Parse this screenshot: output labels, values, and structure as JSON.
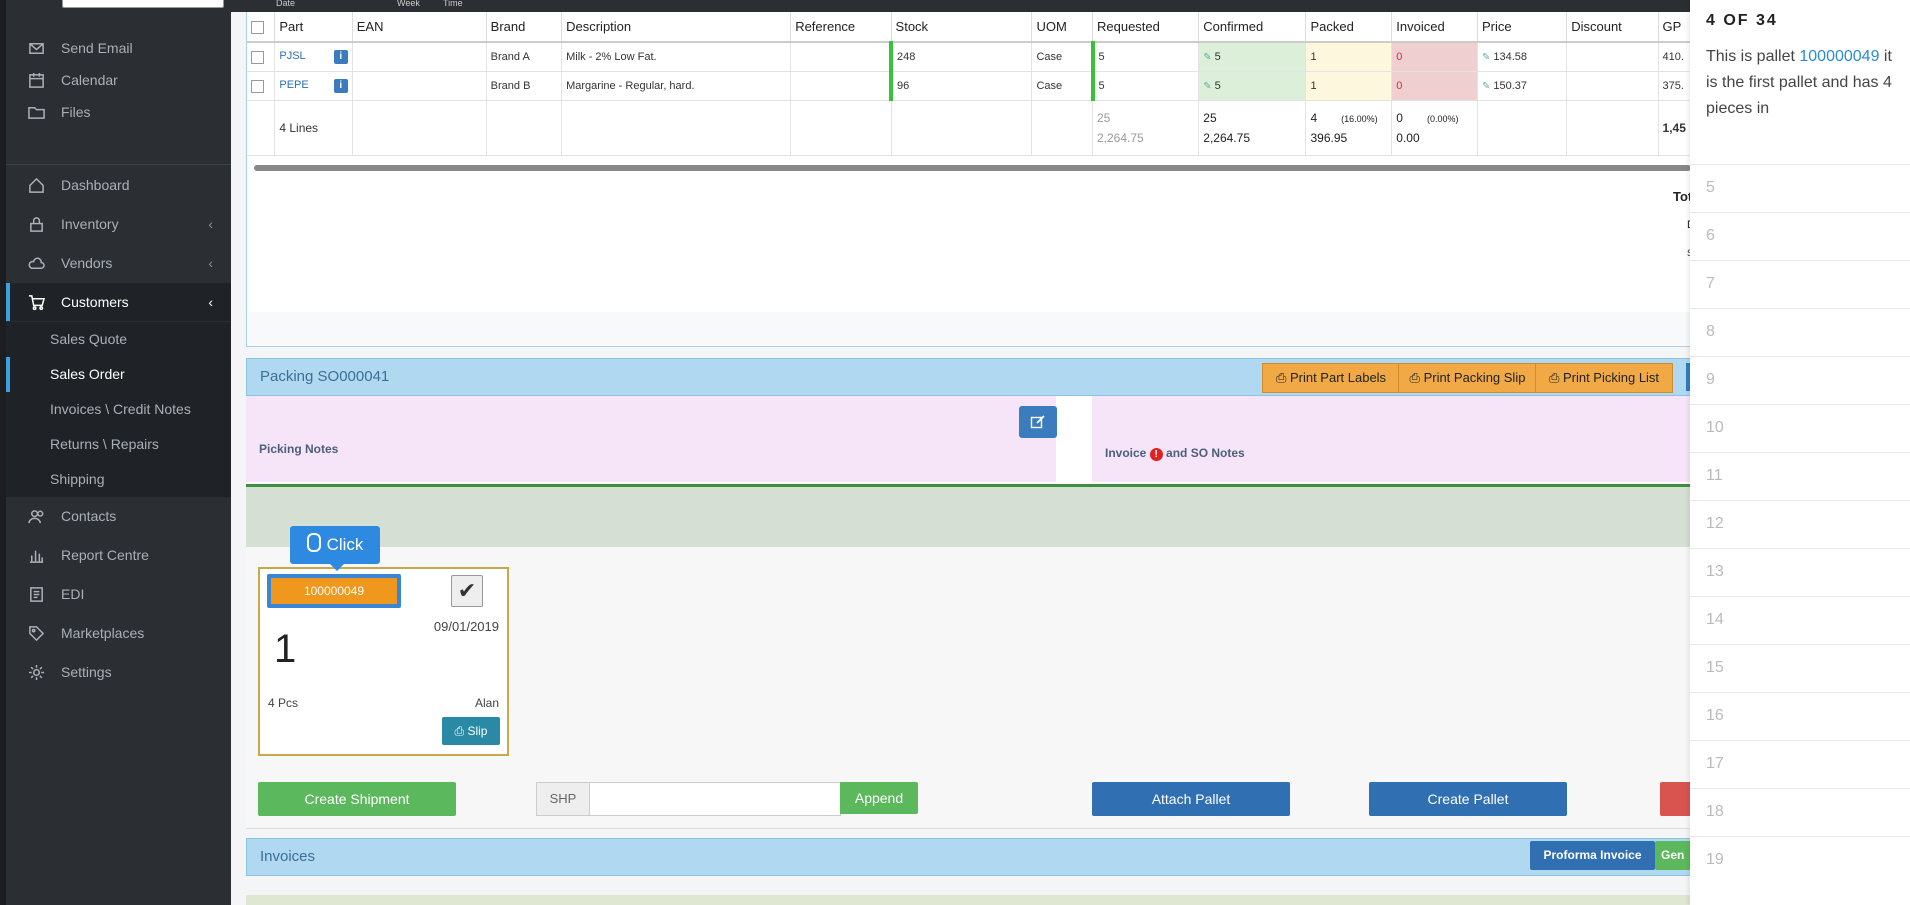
{
  "sidebar": {
    "group1": [
      {
        "label": "Send Email",
        "icon": "mail-icon"
      },
      {
        "label": "Calendar",
        "icon": "calendar-icon"
      },
      {
        "label": "Files",
        "icon": "folder-icon"
      }
    ],
    "group2": [
      {
        "label": "Dashboard",
        "icon": "home-icon"
      },
      {
        "label": "Inventory",
        "icon": "lock-icon"
      },
      {
        "label": "Vendors",
        "icon": "cloud-icon"
      },
      {
        "label": "Customers",
        "icon": "cart-icon"
      }
    ],
    "customers_sub": [
      "Sales Quote",
      "Sales Order",
      "Invoices \\ Credit Notes",
      "Returns \\ Repairs",
      "Shipping"
    ],
    "group3": [
      {
        "label": "Contacts",
        "icon": "contacts-icon"
      },
      {
        "label": "Report Centre",
        "icon": "chart-icon"
      },
      {
        "label": "EDI",
        "icon": "edi-icon"
      },
      {
        "label": "Marketplaces",
        "icon": "tag-icon"
      },
      {
        "label": "Settings",
        "icon": "gear-icon"
      }
    ]
  },
  "datebar": {
    "date": "Date",
    "week": "Week",
    "time": "Time"
  },
  "lines_table": {
    "headers": [
      "",
      "Part",
      "EAN",
      "Brand",
      "Description",
      "Reference",
      "Stock",
      "UOM",
      "Requested",
      "Confirmed",
      "Packed",
      "Invoiced",
      "Price",
      "Discount",
      "GP"
    ],
    "rows": [
      {
        "part": "PJSL",
        "ean": "",
        "brand": "Brand A",
        "description": "Milk - 2% Low Fat.",
        "reference": "",
        "stock": "248",
        "uom": "Case",
        "requested": "5",
        "confirmed": "5",
        "packed": "1",
        "invoiced": "0",
        "price": "134.58",
        "discount": "",
        "gp": "410."
      },
      {
        "part": "PEPE",
        "ean": "",
        "brand": "Brand B",
        "description": "Margarine - Regular, hard.",
        "reference": "",
        "stock": "96",
        "uom": "Case",
        "requested": "5",
        "confirmed": "5",
        "packed": "1",
        "invoiced": "0",
        "price": "150.37",
        "discount": "",
        "gp": "375."
      }
    ],
    "totals": {
      "lines": "4 Lines",
      "requested_qty": "25",
      "requested_val": "2,264.75",
      "confirmed_qty": "25",
      "confirmed_val": "2,264.75",
      "packed_qty": "4",
      "packed_pct": "(16.00%)",
      "packed_val": "396.95",
      "invoiced_qty": "0",
      "invoiced_pct": "(0.00%)",
      "invoiced_val": "0.00",
      "gp": "1,45"
    },
    "side_text": {
      "tot": "Tot",
      "d": "D",
      "s": "S"
    }
  },
  "packing": {
    "title": "Packing SO000041",
    "buttons": [
      "Print Part Labels",
      "Print Packing Slip",
      "Print Picking List"
    ],
    "picking_notes": "Picking Notes",
    "invoice_notes_prefix": "Invoice",
    "invoice_notes_suffix": "and SO Notes",
    "pallet": {
      "id": "100000049",
      "date": "09/01/2019",
      "number": "1",
      "pcs": "4 Pcs",
      "user": "Alan",
      "slip": "Slip"
    },
    "click_tip": "Click",
    "create_shipment": "Create Shipment",
    "shp_prefix": "SHP",
    "shp_value": "",
    "append": "Append",
    "attach_pallet": "Attach Pallet",
    "create_pallet": "Create Pallet"
  },
  "invoices": {
    "title": "Invoices",
    "proforma": "Proforma Invoice",
    "gen": "Gen"
  },
  "tour": {
    "title": "4 OF 34",
    "body_before": "This is pallet",
    "body_link": "100000049",
    "body_after": "it is the first pallet and has 4 pieces in",
    "steps": [
      "5",
      "6",
      "7",
      "8",
      "9",
      "10",
      "11",
      "12",
      "13",
      "14",
      "15",
      "16",
      "17",
      "18",
      "19"
    ]
  },
  "colors": {
    "accent": "#3aa0e0",
    "orange": "#f0a945",
    "green": "#5cb85c",
    "blue": "#2f6fb2",
    "red": "#d9534f"
  }
}
